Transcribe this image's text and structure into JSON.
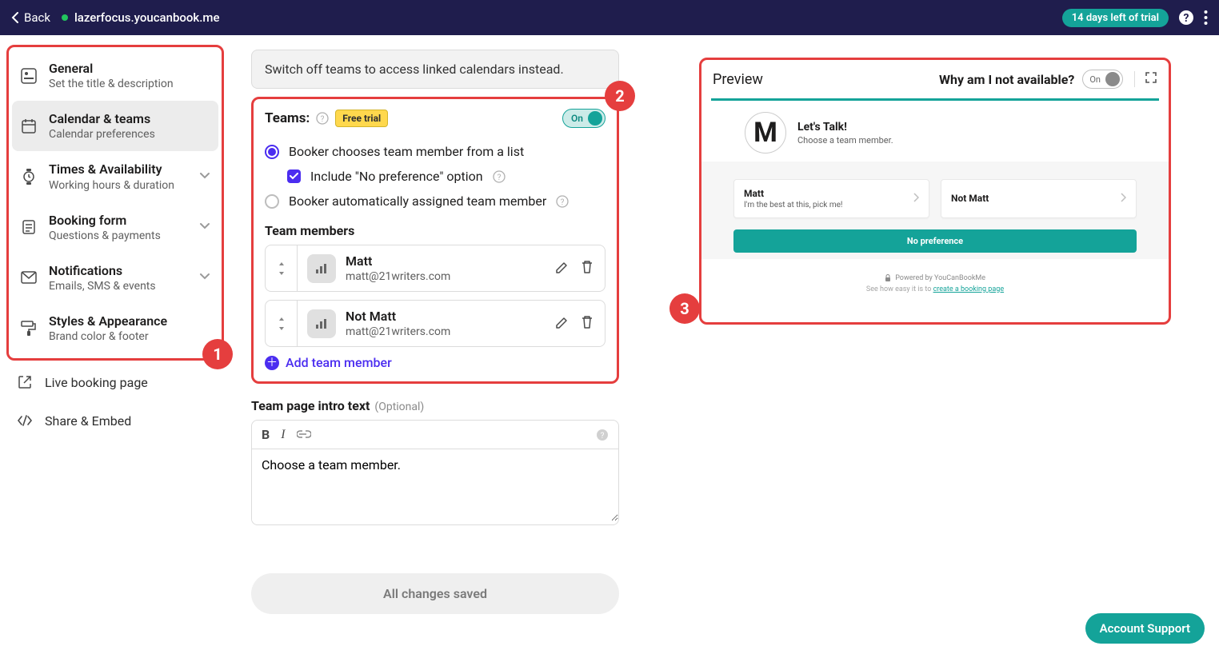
{
  "topbar": {
    "back": "Back",
    "url": "lazerfocus.youcanbook.me",
    "trial": "14 days left of trial"
  },
  "sidebar": {
    "items": [
      {
        "title": "General",
        "sub": "Set the title & description",
        "expand": false
      },
      {
        "title": "Calendar & teams",
        "sub": "Calendar preferences",
        "expand": false
      },
      {
        "title": "Times & Availability",
        "sub": "Working hours & duration",
        "expand": true
      },
      {
        "title": "Booking form",
        "sub": "Questions & payments",
        "expand": true
      },
      {
        "title": "Notifications",
        "sub": "Emails, SMS & events",
        "expand": true
      },
      {
        "title": "Styles & Appearance",
        "sub": "Brand color & footer",
        "expand": false
      }
    ],
    "live": "Live booking page",
    "share": "Share & Embed"
  },
  "form": {
    "banner": "Switch off teams to access linked calendars instead.",
    "teams_label": "Teams:",
    "free_trial": "Free trial",
    "toggle_on": "On",
    "radio1": "Booker chooses team member from a list",
    "check1": "Include \"No preference\" option",
    "radio2": "Booker automatically assigned team member",
    "members_header": "Team members",
    "members": [
      {
        "name": "Matt",
        "email": "matt@21writers.com"
      },
      {
        "name": "Not Matt",
        "email": "matt@21writers.com"
      }
    ],
    "add": "Add team member",
    "intro_label": "Team page intro text",
    "intro_optional": "(Optional)",
    "intro_text": "Choose a team member.",
    "save": "All changes saved"
  },
  "preview": {
    "title": "Preview",
    "why": "Why am I not available?",
    "toggle": "On",
    "logo_letter": "M",
    "header_title": "Let's Talk!",
    "header_sub": "Choose a team member.",
    "options": [
      {
        "name": "Matt",
        "sub": "I'm the best at this, pick me!"
      },
      {
        "name": "Not Matt",
        "sub": ""
      }
    ],
    "no_pref": "No preference",
    "powered_1": "Powered by YouCanBookMe",
    "powered_2a": "See how easy it is to ",
    "powered_2b": "create a booking page"
  },
  "support": "Account Support",
  "callouts": {
    "c1": "1",
    "c2": "2",
    "c3": "3"
  }
}
